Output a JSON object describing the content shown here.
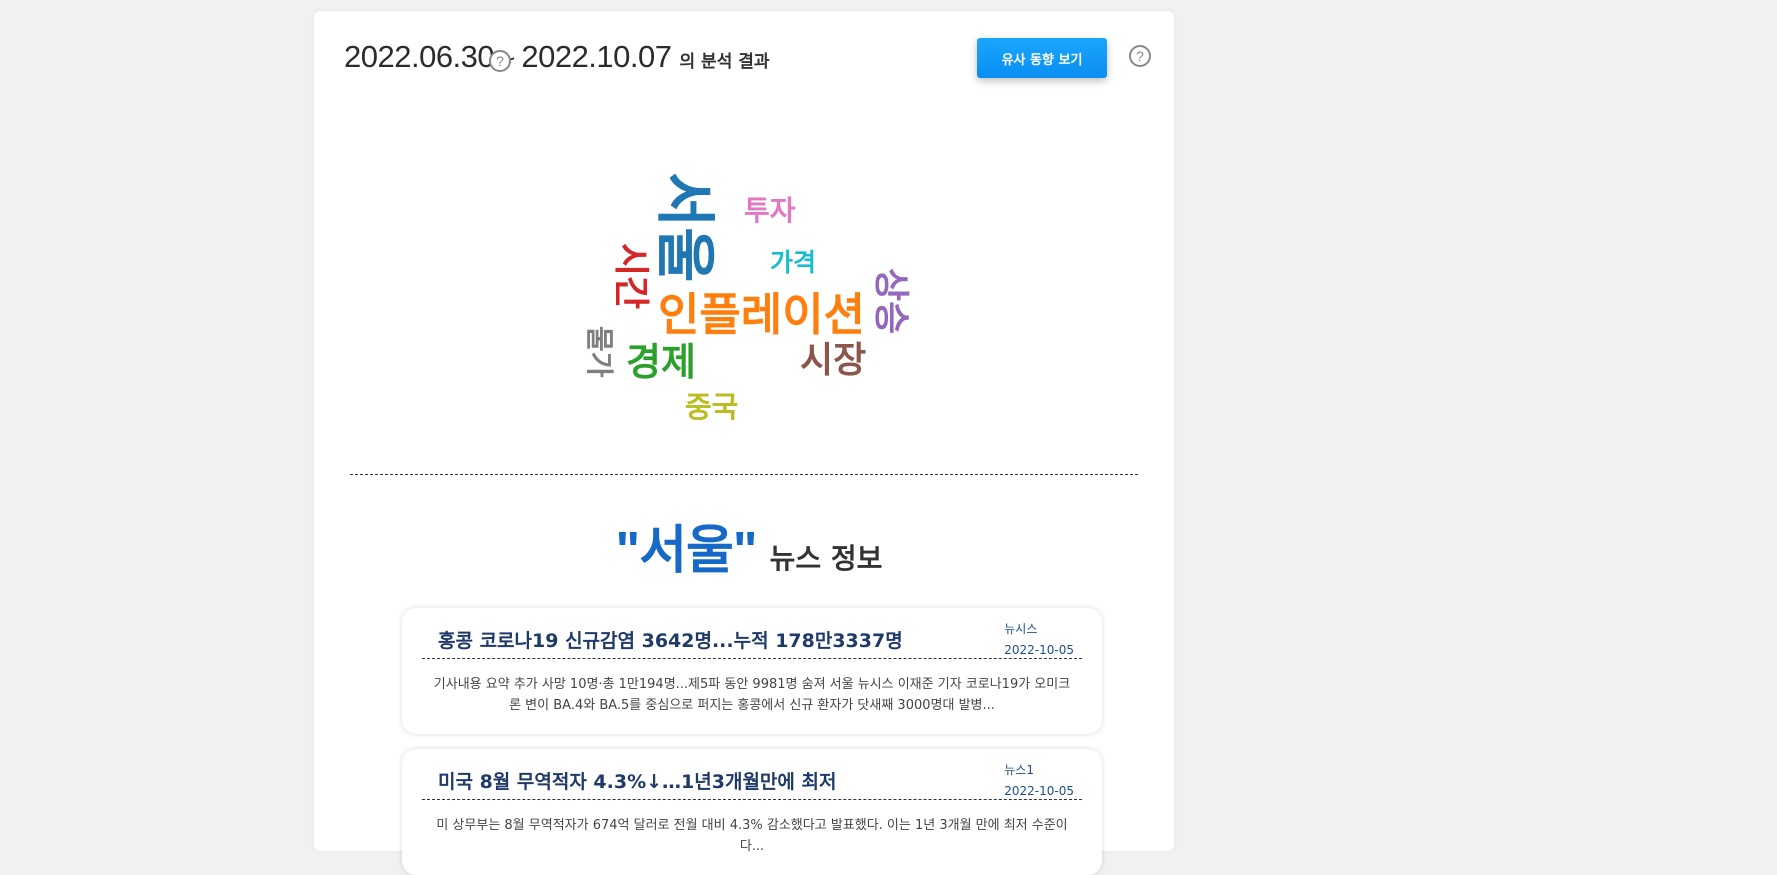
{
  "header": {
    "date_start": "2022.06.30",
    "separator": "~",
    "date_end": "2022.10.07",
    "suffix": "의 분석 결과",
    "help_glyph": "?",
    "similar_button": "유사 동향 보기"
  },
  "word_cloud": [
    {
      "text": "서울",
      "color": "#1f77b4"
    },
    {
      "text": "투자",
      "color": "#e377c2"
    },
    {
      "text": "가격",
      "color": "#17becf"
    },
    {
      "text": "시간",
      "color": "#d62728"
    },
    {
      "text": "상승",
      "color": "#9467bd"
    },
    {
      "text": "인플레이션",
      "color": "#ff7f0e"
    },
    {
      "text": "물가",
      "color": "#7f7f7f"
    },
    {
      "text": "경제",
      "color": "#2ca02c"
    },
    {
      "text": "시장",
      "color": "#8c564b"
    },
    {
      "text": "중국",
      "color": "#bcbd22"
    }
  ],
  "news_section": {
    "keyword": "\"서울\"",
    "suffix": "뉴스 정보",
    "items": [
      {
        "title": "홍콩 코로나19 신규감염 3642명...누적 178만3337명",
        "source": "뉴시스",
        "date": "2022-10-05",
        "summary": "기사내용 요약 추가 사망 10명·총 1만194명...제5파 동안 9981명 숨져 서울 뉴시스 이재준 기자 코로나19가 오미크론 변이 BA.4와 BA.5를 중심으로 퍼지는 홍콩에서 신규 환자가 닷새째 3000명대 발병..."
      },
      {
        "title": "미국 8월 무역적자 4.3%↓…1년3개월만에 최저",
        "source": "뉴스1",
        "date": "2022-10-05",
        "summary": "미 상무부는 8월 무역적자가 674억 달러로 전월 대비 4.3% 감소했다고 발표했다. 이는 1년 3개월 만에 최저 수준이다..."
      }
    ]
  }
}
